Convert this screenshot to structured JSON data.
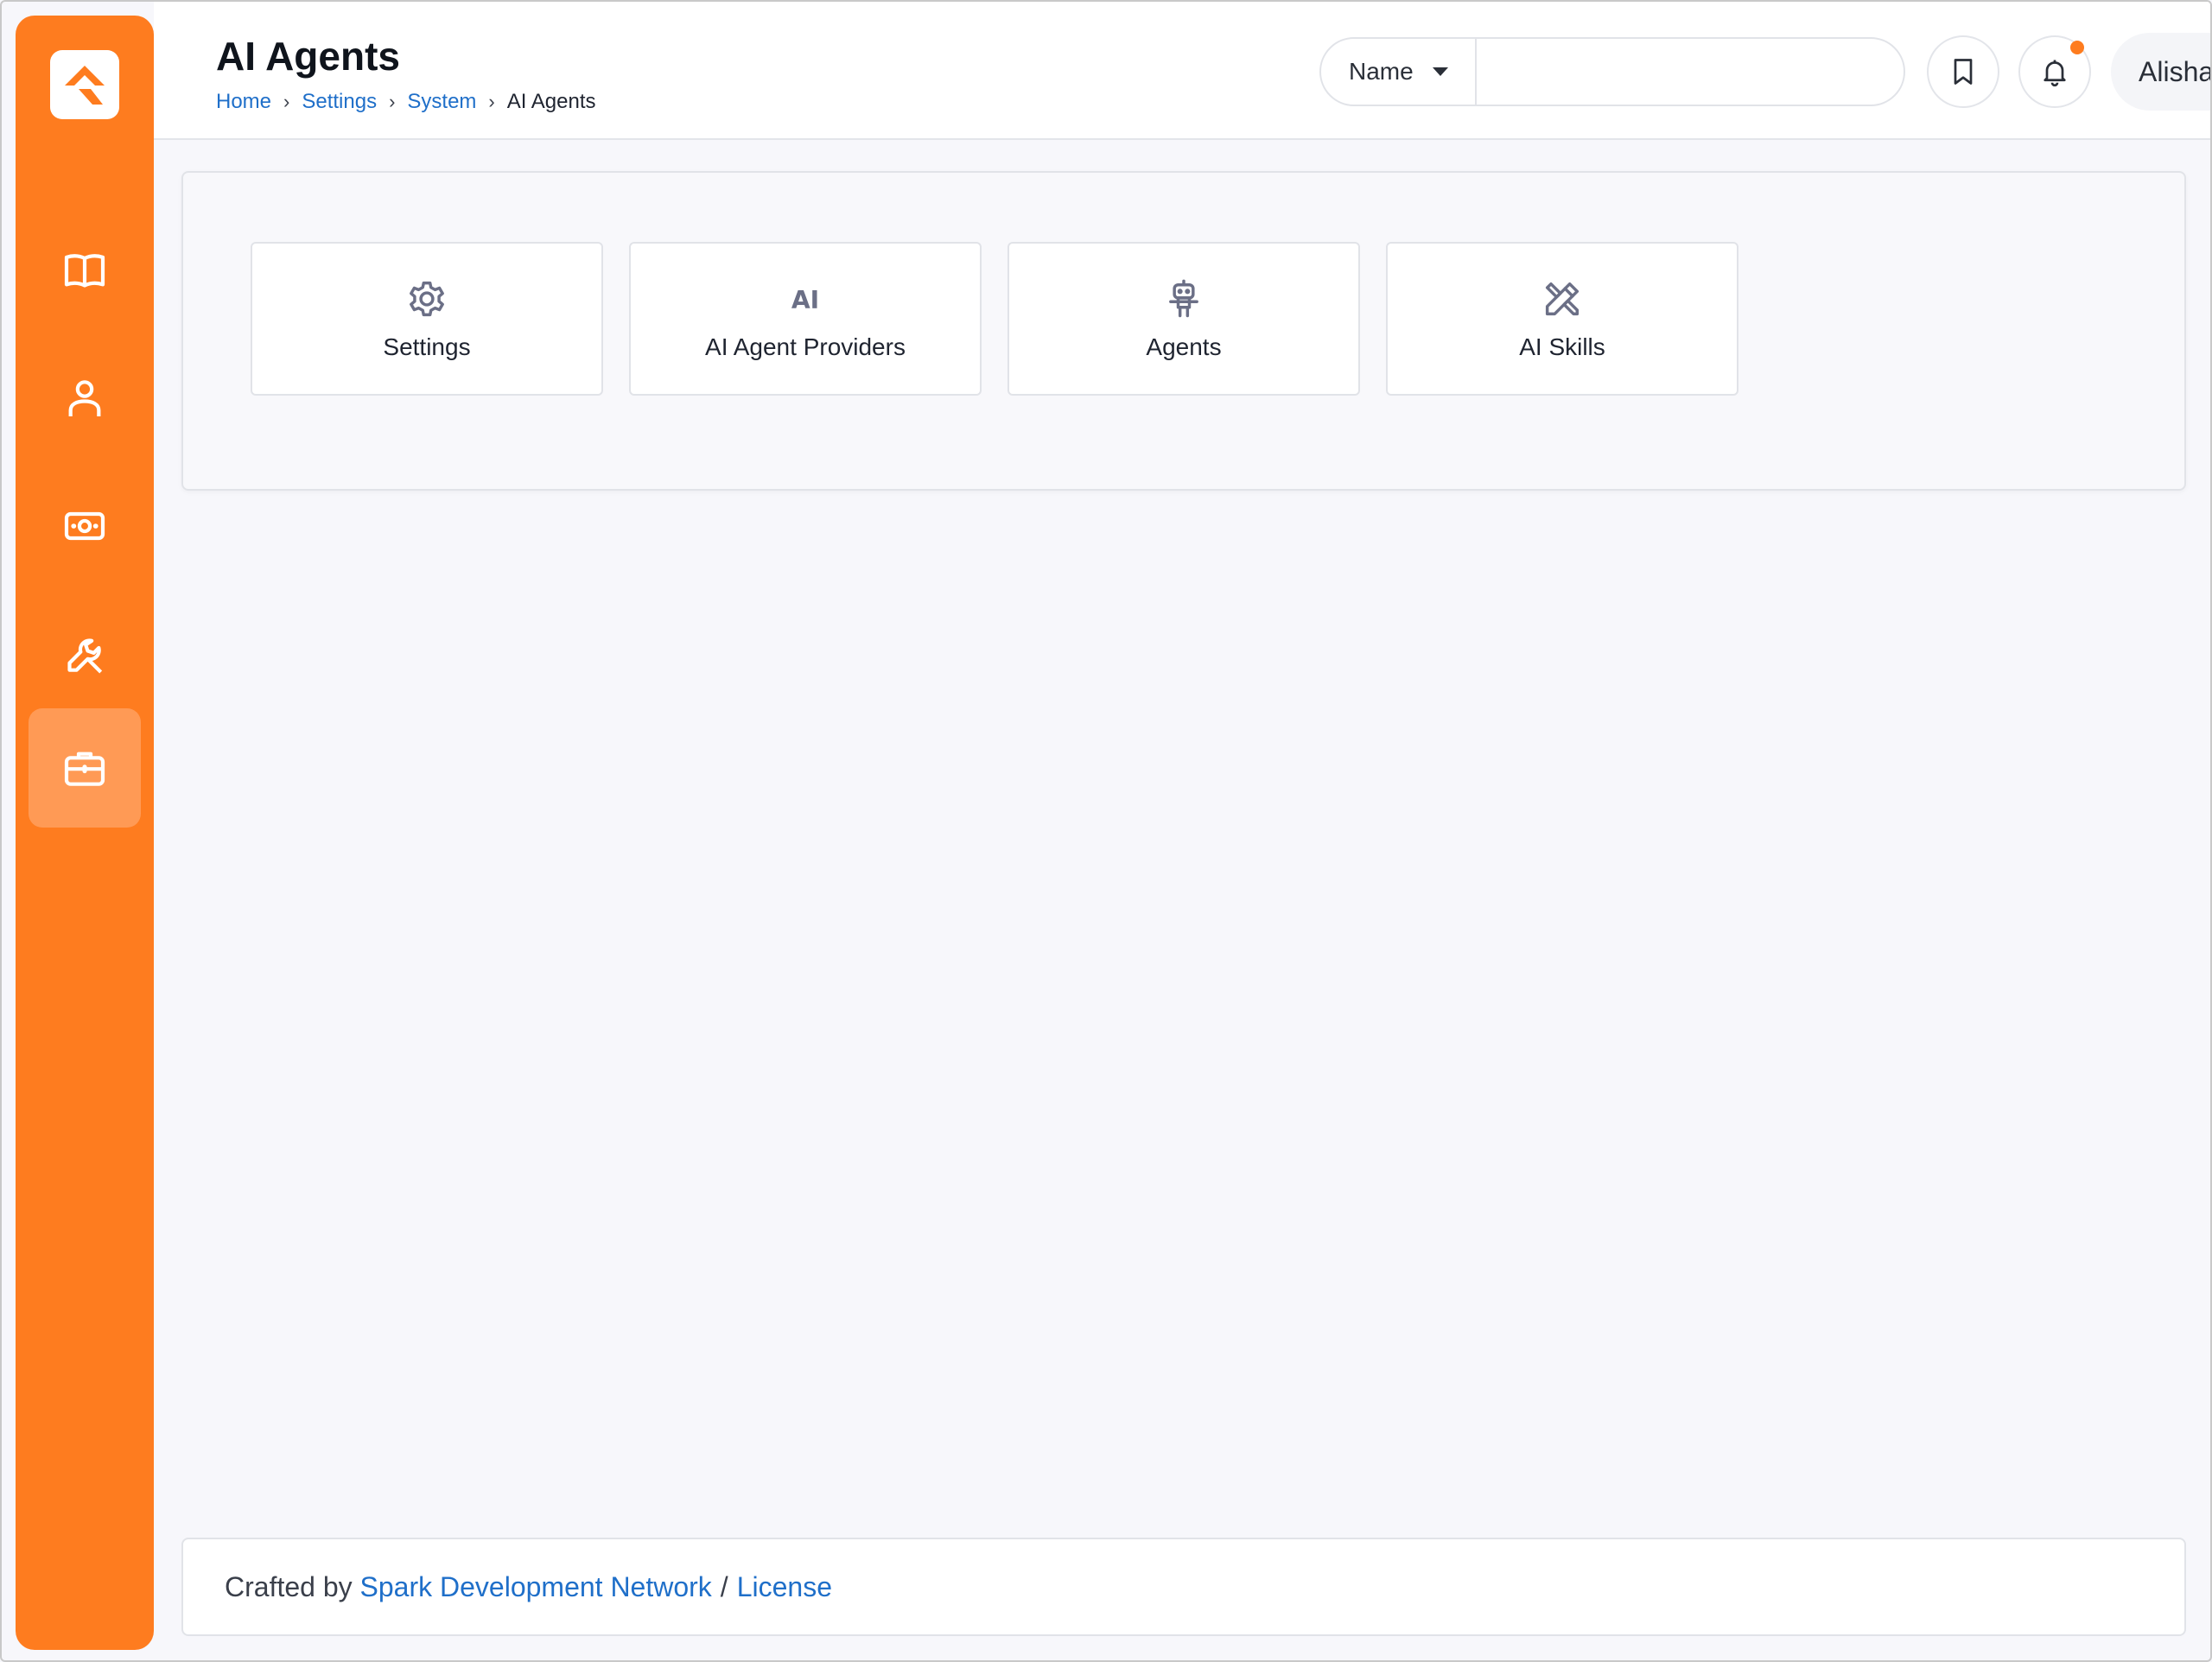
{
  "header": {
    "title": "AI Agents",
    "breadcrumb": [
      "Home",
      "Settings",
      "System",
      "AI Agents"
    ],
    "search": {
      "field_select": "Name",
      "value": "",
      "placeholder": ""
    },
    "user": {
      "name": "Alisha"
    }
  },
  "sidebar": {
    "items": [
      {
        "icon": "book-icon"
      },
      {
        "icon": "user-icon"
      },
      {
        "icon": "money-icon"
      },
      {
        "icon": "wrench-icon"
      },
      {
        "icon": "briefcase-icon",
        "active": true
      }
    ]
  },
  "cards": [
    {
      "label": "Settings",
      "icon": "gear-icon"
    },
    {
      "label": "AI Agent Providers",
      "icon": "ai-icon",
      "glyph": "AI"
    },
    {
      "label": "Agents",
      "icon": "robot-icon"
    },
    {
      "label": "AI Skills",
      "icon": "tools-icon"
    }
  ],
  "footer": {
    "prefix": "Crafted by",
    "author_link": "Spark Development Network",
    "separator": "/",
    "license_link": "License"
  },
  "colors": {
    "accent": "#fe7c1f",
    "sidebar_active": "#ff9a55",
    "link": "#1f6fc9",
    "background": "#f7f7fb"
  }
}
